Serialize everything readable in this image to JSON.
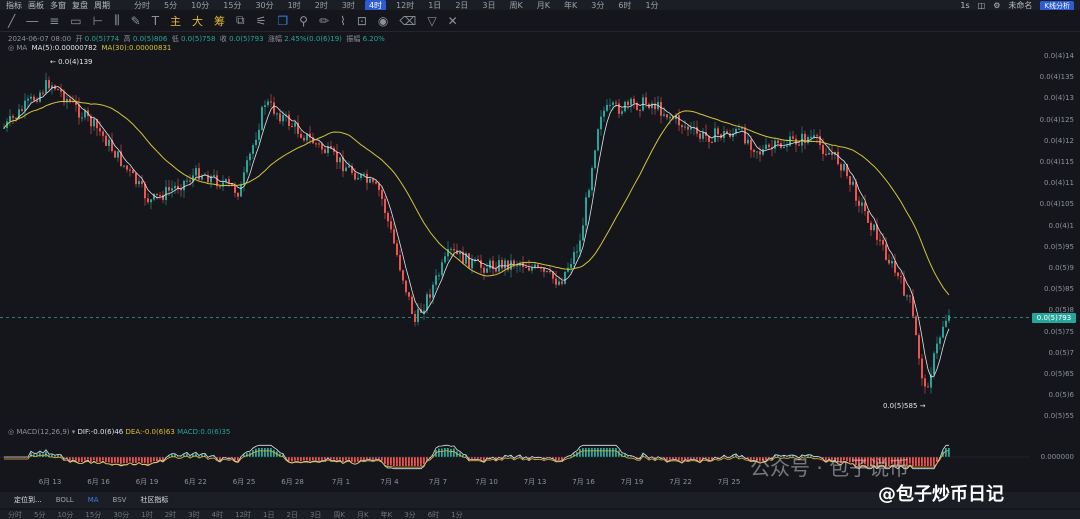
{
  "toolbar": {
    "items": [
      "指标",
      "画板",
      "多窗",
      "复盘",
      "周期"
    ],
    "timeframes": [
      "分时",
      "5分",
      "10分",
      "15分",
      "30分",
      "1时",
      "2时",
      "3时",
      "4时",
      "12时",
      "1日",
      "2日",
      "3日",
      "周K",
      "月K",
      "年K",
      "3分",
      "6时",
      "1分"
    ],
    "active_timeframe": "4时",
    "right_interval": "1s",
    "right_labels": [
      "未命名"
    ],
    "kline_button": "K线分析"
  },
  "draw_toolbar": {
    "chips": [
      "主",
      "大",
      "筹"
    ]
  },
  "info": {
    "date": "2024-06-07 08:00",
    "open_label": "开",
    "open": "0.0(5)774",
    "high_label": "高",
    "high": "0.0(5)806",
    "low_label": "低",
    "low": "0.0(5)758",
    "close_label": "收",
    "close": "0.0(5)793",
    "change_label": "涨幅",
    "change": "2.45%(0.0(6)19)",
    "amp_label": "振幅",
    "amp": "6.20%"
  },
  "ma": {
    "label": "MA",
    "ma5": "MA(5):0.00000782",
    "ma30": "MA(30):0.00000831"
  },
  "annotations": {
    "high": "← 0.0(4)139",
    "low": "0.0(5)585 →"
  },
  "price_axis": [
    "0.0(4)14",
    "0.0(4)135",
    "0.0(4)13",
    "0.0(4)125",
    "0.0(4)12",
    "0.0(4)115",
    "0.0(4)11",
    "0.0(4)105",
    "0.0(4)1",
    "0.0(5)95",
    "0.0(5)9",
    "0.0(5)85",
    "0.0(5)8",
    "0.0(5)75",
    "0.0(5)7",
    "0.0(5)65",
    "0.0(5)6",
    "0.0(5)55"
  ],
  "current_price": "0.0(5)793",
  "macd": {
    "label": "MACD(12,26,9)",
    "dif": "DIF:-0.0(6)46",
    "dea": "DEA:-0.0(6)63",
    "macd": "MACD:0.0(6)35",
    "zero_label": "0.000000"
  },
  "dates": [
    "6月 13",
    "6月 16",
    "6月 19",
    "6月 22",
    "6月 25",
    "6月 28",
    "7月 1",
    "7月 4",
    "7月 7",
    "7月 10",
    "7月 13",
    "7月 16",
    "7月 19",
    "7月 22",
    "7月 25"
  ],
  "bottom": {
    "items": [
      "定位到...",
      "BOLL",
      "MA",
      "BSV",
      "社区指标"
    ],
    "active": "MA"
  },
  "bottom2": [
    "分时",
    "5分",
    "10分",
    "15分",
    "30分",
    "1时",
    "2时",
    "3时",
    "4时",
    "12时",
    "1日",
    "2日",
    "3日",
    "周K",
    "月K",
    "年K",
    "3分",
    "6时",
    "1分"
  ],
  "watermark": {
    "line1": "公众号 · 包子说币",
    "line2": "@包子炒币日记"
  },
  "colors": {
    "up": "#26a69a",
    "down": "#ef5350",
    "ma5": "#e0e3e8",
    "ma30": "#d4c33a",
    "accent": "#2c5bd6"
  }
}
